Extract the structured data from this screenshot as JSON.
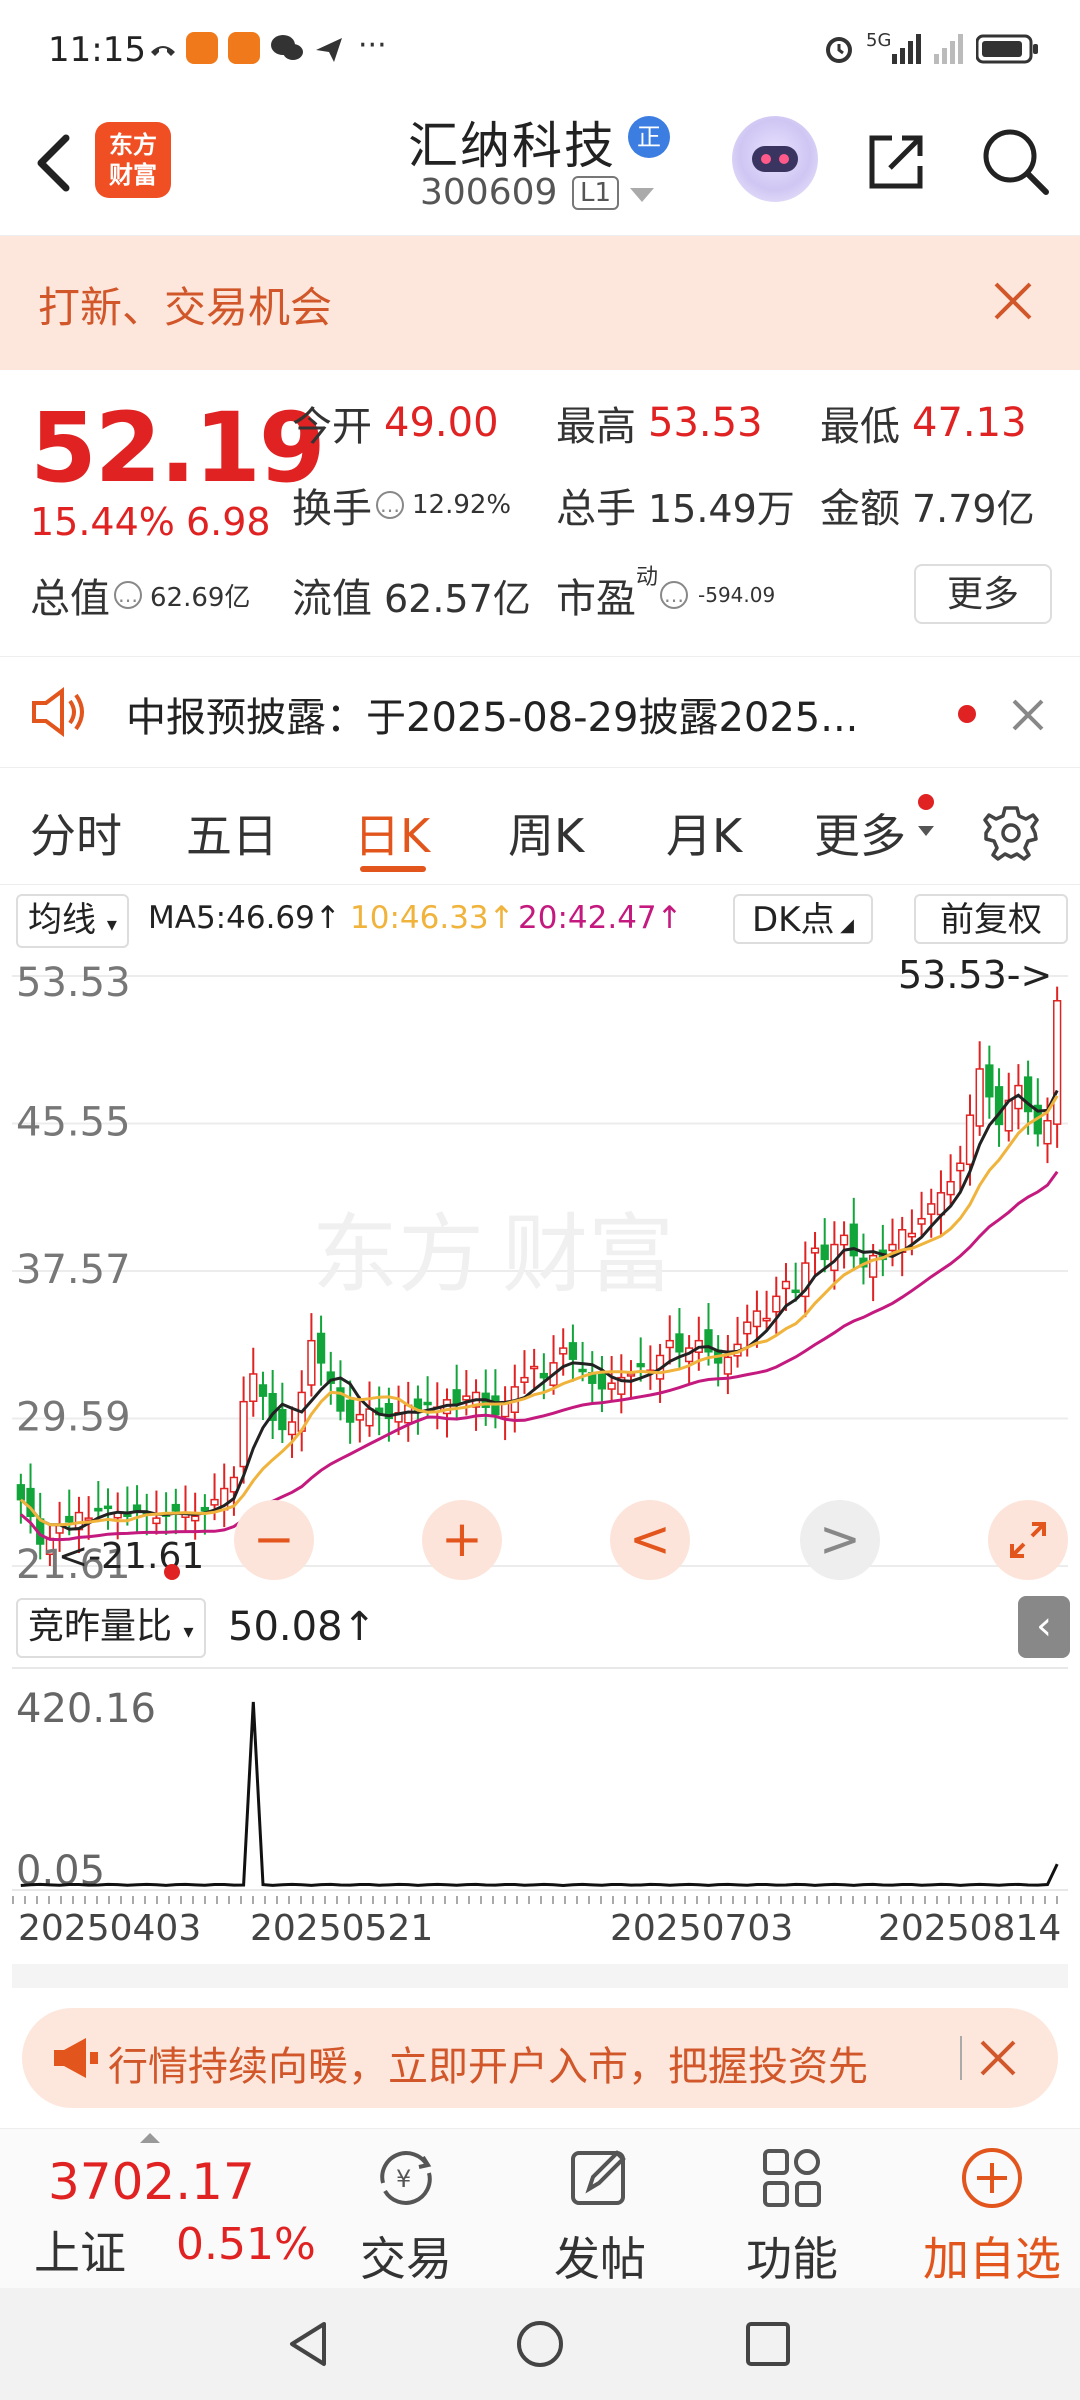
{
  "status_bar": {
    "time": "11:15",
    "more": "···",
    "signal": "5G"
  },
  "header": {
    "logo_line1": "东方",
    "logo_line2": "财富",
    "stock_name": "汇纳科技",
    "badge": "正",
    "stock_code": "300609",
    "level": "L1"
  },
  "banner": {
    "text": "打新、交易机会"
  },
  "quote": {
    "price": "52.19",
    "change_pct": "15.44%",
    "change_abs": "6.98",
    "open_label": "今开",
    "open": "49.00",
    "high_label": "最高",
    "high": "53.53",
    "low_label": "最低",
    "low": "47.13",
    "turnover_label": "换手",
    "turnover": "12.92%",
    "volume_label": "总手",
    "volume": "15.49万",
    "amount_label": "金额",
    "amount": "7.79亿",
    "mcap_label": "总值",
    "mcap": "62.69亿",
    "float_label": "流值",
    "float_cap": "62.57亿",
    "pe_label": "市盈",
    "pe_sup": "动",
    "pe": "-594.09",
    "more_label": "更多"
  },
  "notice": {
    "text": "中报预披露：于2025-08-29披露2025..."
  },
  "tabs": [
    {
      "label": "分时"
    },
    {
      "label": "五日"
    },
    {
      "label": "日K"
    },
    {
      "label": "周K"
    },
    {
      "label": "月K"
    },
    {
      "label": "更多"
    }
  ],
  "ma": {
    "selector": "均线",
    "ma5": "MA5:46.69↑",
    "ma10": "10:46.33↑",
    "ma20": "20:42.47↑",
    "dk": "DK点",
    "adjust": "前复权"
  },
  "colors": {
    "up": "#e02222",
    "down": "#11a53a",
    "ma5": "#222222",
    "ma10": "#f0b33c",
    "ma20": "#c4197e",
    "accent": "#e2551c"
  },
  "chart_data": {
    "type": "candlestick",
    "y_ticks": [
      "53.53",
      "45.55",
      "37.57",
      "29.59",
      "21.61"
    ],
    "ylim": [
      21.61,
      53.53
    ],
    "max_label": "53.53->",
    "min_label": "<-21.61",
    "closes": [
      25.2,
      24.3,
      22.8,
      23.1,
      23.8,
      24.0,
      24.5,
      24.2,
      24.6,
      24.8,
      24.5,
      24.3,
      24.6,
      24.5,
      24.2,
      24.4,
      24.6,
      24.5,
      24.3,
      24.6,
      25.2,
      25.8,
      26.4,
      30.5,
      32.0,
      30.8,
      29.5,
      29.0,
      29.4,
      31.0,
      33.8,
      32.6,
      31.5,
      30.0,
      29.4,
      29.8,
      30.1,
      29.8,
      29.6,
      29.9,
      30.3,
      30.0,
      30.4,
      30.2,
      30.6,
      30.4,
      30.8,
      31.0,
      30.2,
      29.8,
      30.5,
      31.3,
      31.8,
      32.4,
      31.8,
      32.6,
      33.4,
      32.8,
      32.2,
      31.5,
      31.2,
      31.5,
      31.8,
      32.0,
      32.4,
      32.2,
      33.0,
      33.8,
      33.2,
      33.4,
      33.8,
      33.2,
      32.6,
      32.9,
      33.6,
      34.8,
      35.4,
      35.0,
      36.2,
      37.0,
      36.5,
      38.0,
      38.8,
      38.2,
      39.0,
      39.5,
      38.4,
      37.8,
      38.4,
      38.2,
      39.0,
      39.8,
      39.6,
      40.4,
      41.2,
      41.8,
      42.4,
      43.4,
      46.0,
      48.5,
      47.0,
      45.5,
      46.8,
      47.6,
      46.2,
      45.0,
      45.7,
      52.19
    ],
    "ma5_last": 46.69,
    "ma10_last": 46.33,
    "ma20_last": 42.47
  },
  "controls": {
    "zoom_out": "−",
    "zoom_in": "+",
    "prev": "<",
    "next": ">"
  },
  "volume": {
    "selector": "竞昨量比",
    "value": "50.08↑",
    "max_label": "420.16",
    "min_label": "0.05",
    "spike_index": 24,
    "dates": [
      "20250403",
      "20250521",
      "20250703",
      "20250814"
    ]
  },
  "ad": {
    "text": "行情持续向暖，立即开户入市，把握投资先"
  },
  "bottom_nav": {
    "index_value": "3702.17",
    "index_name": "上证",
    "index_pct": "0.51%",
    "items": [
      {
        "label": "交易"
      },
      {
        "label": "发帖"
      },
      {
        "label": "功能"
      },
      {
        "label": "加自选"
      }
    ]
  }
}
